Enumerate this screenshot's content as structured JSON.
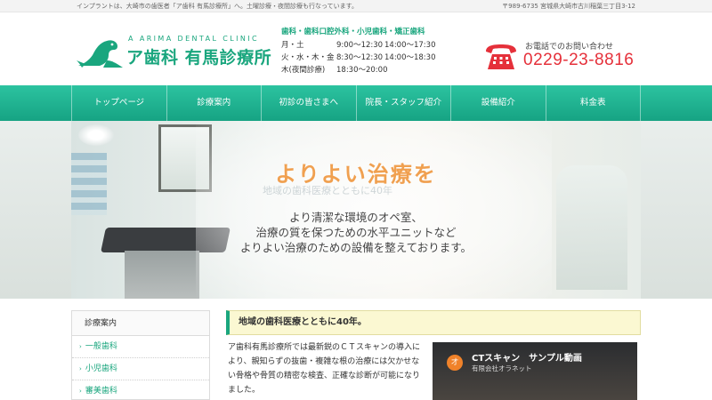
{
  "topbar": {
    "note": "インプラントは、大崎市の歯医者「ア歯科 有馬診療所」へ。土曜診療・夜間診療も行なっています。",
    "address": "〒989-6735 宮城県大崎市古川稲葉三丁目3-12"
  },
  "logo": {
    "en": "A ARIMA DENTAL CLINIC",
    "jp": "ア歯科 有馬診療所"
  },
  "hours": {
    "departments": "歯科・歯科口腔外科・小児歯科・矯正歯科",
    "rows": [
      {
        "days": "月・土",
        "am": "9:00〜12:30",
        "pm": "14:00〜17:30"
      },
      {
        "days": "火・水・木・金",
        "am": "8:30〜12:30",
        "pm": "14:00〜18:30"
      },
      {
        "days": "木(夜間診療)",
        "am": "18:30〜20:00",
        "pm": ""
      }
    ]
  },
  "phone": {
    "label": "お電話でのお問い合わせ",
    "number": "0229-23-8816"
  },
  "nav": [
    "トップページ",
    "診療案内",
    "初診の皆さまへ",
    "院長・スタッフ紹介",
    "設備紹介",
    "料金表"
  ],
  "hero": {
    "headline": "よりよい治療を",
    "ghost_text": "地域の歯科医療とともに40年",
    "lines": [
      "より清潔な環境のオペ室、",
      "治療の質を保つための水平ユニットなど",
      "よりよい治療のための設備を整えております。"
    ]
  },
  "sidebar": {
    "title": "診療案内",
    "items": [
      "一般歯科",
      "小児歯科",
      "審美歯科"
    ]
  },
  "main": {
    "heading": "地域の歯科医療とともに40年。",
    "body": "ア歯科有馬診療所では最新鋭のＣＴスキャンの導入により、親知らずの抜歯・複雑な根の治療には欠かせない骨格や骨質の精密な検査、正確な診断が可能になりました。"
  },
  "video": {
    "channel_initial": "オ",
    "title": "CTスキャン　サンプル動画",
    "channel": "有限会社オラネット"
  },
  "colors": {
    "brand": "#1aa67e",
    "nav": "#1fb08f",
    "phone": "#e5303a",
    "hero_title": "#f0a050"
  }
}
